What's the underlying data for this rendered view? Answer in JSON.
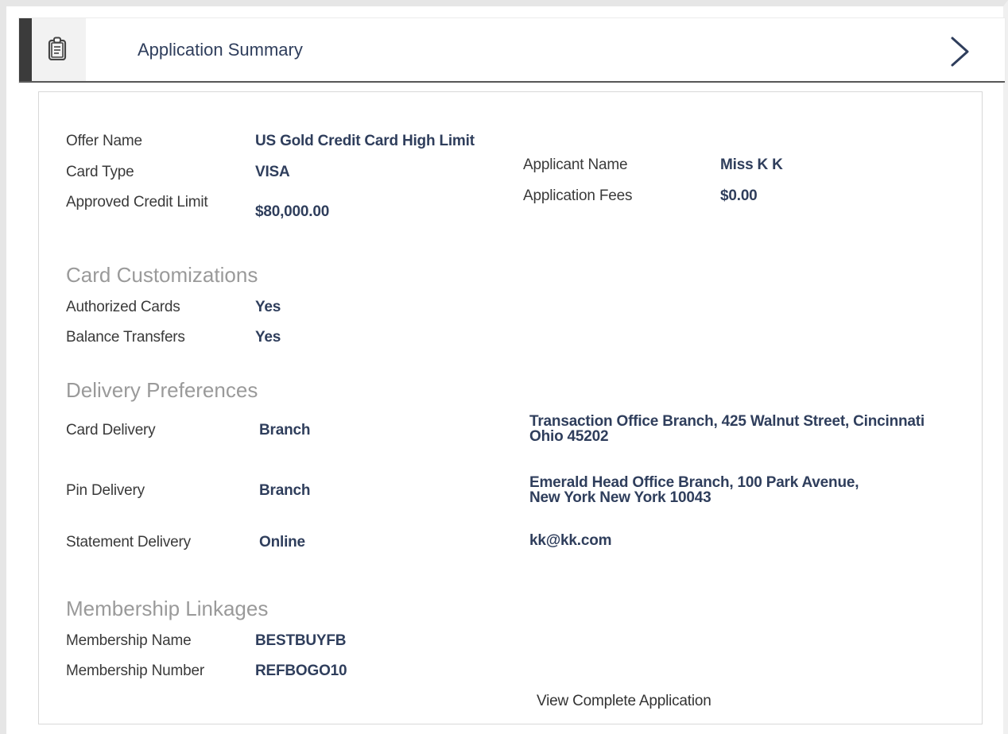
{
  "header": {
    "title": "Application Summary",
    "icon": "clipboard-icon",
    "next_icon": "chevron-right-icon"
  },
  "offer": {
    "offer_name_label": "Offer Name",
    "offer_name_value": "US Gold Credit Card High Limit",
    "card_type_label": "Card Type",
    "card_type_value": "VISA",
    "approved_credit_limit_label": "Approved Credit Limit",
    "approved_credit_limit_value": "$80,000.00",
    "applicant_name_label": "Applicant Name",
    "applicant_name_value": "Miss K K",
    "application_fees_label": "Application Fees",
    "application_fees_value": "$0.00"
  },
  "customizations": {
    "heading": "Card Customizations",
    "authorized_cards_label": "Authorized Cards",
    "authorized_cards_value": "Yes",
    "balance_transfers_label": "Balance Transfers",
    "balance_transfers_value": "Yes"
  },
  "delivery": {
    "heading": "Delivery Preferences",
    "card_delivery_label": "Card Delivery",
    "card_delivery_value": "Branch",
    "card_delivery_address": "Transaction Office Branch, 425 Walnut Street, Cincinnati Ohio 45202",
    "pin_delivery_label": "Pin Delivery",
    "pin_delivery_value": "Branch",
    "pin_delivery_address": "Emerald Head Office Branch, 100 Park Avenue, New York New York 10043",
    "statement_delivery_label": "Statement Delivery",
    "statement_delivery_value": "Online",
    "statement_delivery_address": "kk@kk.com"
  },
  "membership": {
    "heading": "Membership Linkages",
    "membership_name_label": "Membership Name",
    "membership_name_value": "BESTBUYFB",
    "membership_number_label": "Membership Number",
    "membership_number_value": "REFBOGO10"
  },
  "actions": {
    "view_complete_application": "View Complete Application"
  }
}
